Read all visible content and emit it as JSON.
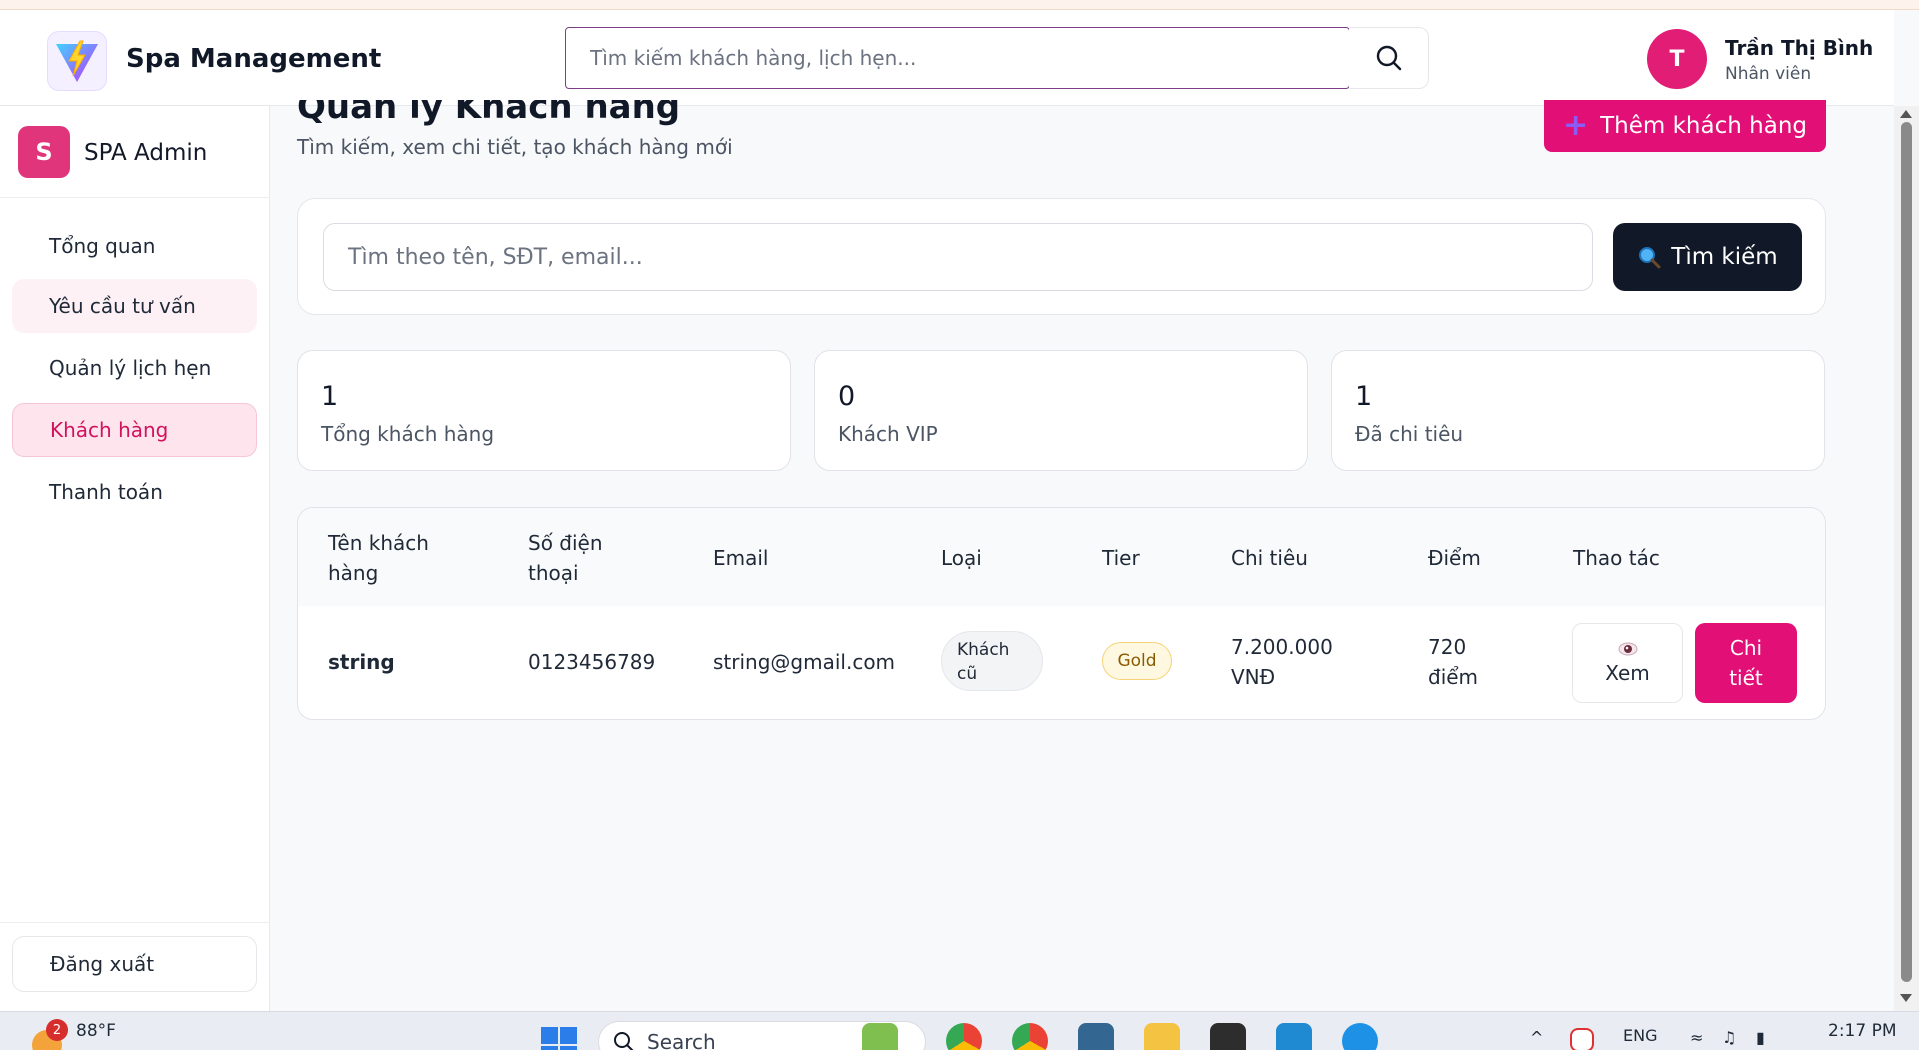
{
  "header": {
    "app_title": "Spa Management",
    "search_placeholder": "Tìm kiếm khách hàng, lịch hẹn...",
    "user": {
      "initial": "T",
      "name": "Trần Thị Bình",
      "role": "Nhân viên"
    }
  },
  "sidebar": {
    "brand_initial": "S",
    "brand_name": "SPA Admin",
    "items": [
      {
        "label": "Tổng quan"
      },
      {
        "label": "Yêu cầu tư vấn"
      },
      {
        "label": "Quản lý lịch hẹn"
      },
      {
        "label": "Khách hàng"
      },
      {
        "label": "Thanh toán"
      }
    ],
    "logout_label": "Đăng xuất"
  },
  "main": {
    "title": "Quản lý Khách hàng",
    "subtitle": "Tìm kiếm, xem chi tiết, tạo khách hàng mới",
    "add_button": "Thêm khách hàng",
    "search": {
      "placeholder": "Tìm theo tên, SĐT, email...",
      "button": "Tìm kiếm"
    },
    "stats": [
      {
        "value": "1",
        "label": "Tổng khách hàng"
      },
      {
        "value": "0",
        "label": "Khách VIP"
      },
      {
        "value": "1",
        "label": "Đã chi tiêu"
      }
    ],
    "table": {
      "headers": {
        "name": [
          "Tên khách",
          "hàng"
        ],
        "phone": [
          "Số điện",
          "thoại"
        ],
        "email": "Email",
        "type": "Loại",
        "tier": "Tier",
        "spent": "Chi tiêu",
        "points": "Điểm",
        "actions": "Thao tác"
      },
      "rows": [
        {
          "name": "string",
          "phone": "0123456789",
          "email": "string@gmail.com",
          "type": [
            "Khách",
            "cũ"
          ],
          "tier": "Gold",
          "spent": [
            "7.200.000",
            "VNĐ"
          ],
          "points": [
            "720",
            "điểm"
          ],
          "view_label": "Xem",
          "detail_label": [
            "Chi",
            "tiết"
          ]
        }
      ]
    }
  },
  "taskbar": {
    "weather_badge": "2",
    "weather_temp": "88°F",
    "search_label": "Search",
    "language": "ENG",
    "time": "2:17 PM"
  },
  "colors": {
    "accent": "#e10f76",
    "dark_button": "#111827",
    "active_nav_bg": "#fde4ed"
  }
}
